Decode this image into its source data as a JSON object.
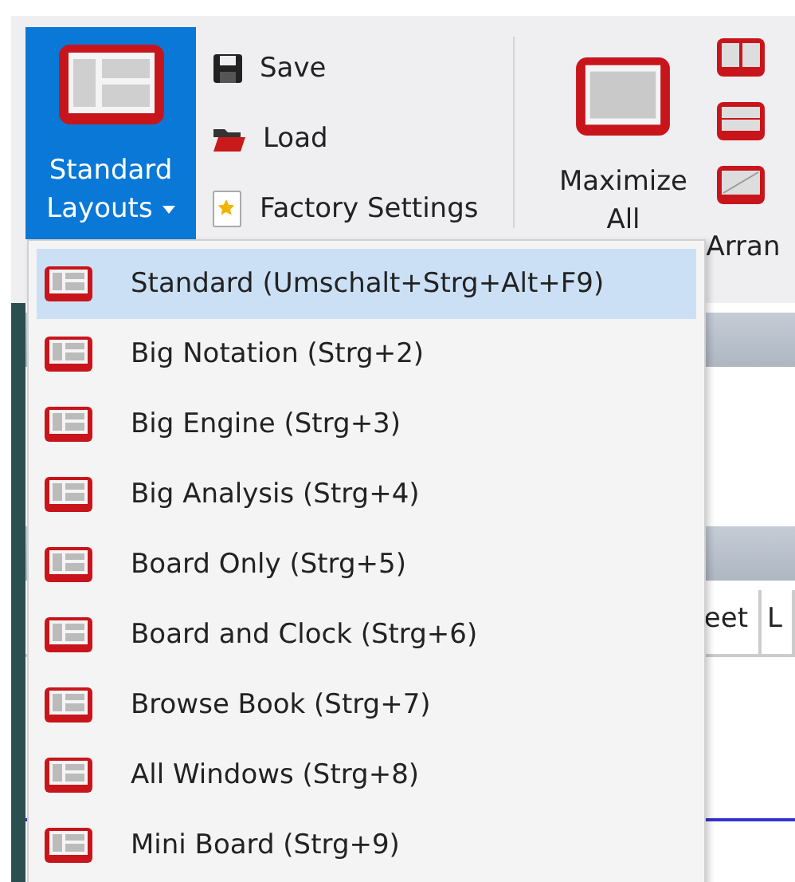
{
  "ribbon": {
    "layouts_button": {
      "label_lines": [
        "Standard",
        "Layouts"
      ],
      "expanded": true
    },
    "commands": [
      {
        "label": "Save",
        "kind": "save"
      },
      {
        "label": "Load",
        "kind": "load"
      },
      {
        "label": "Factory Settings",
        "kind": "factory"
      }
    ],
    "maximize_button": {
      "label_lines": [
        "Maximize",
        "All"
      ]
    },
    "group_label": "Arran"
  },
  "menu": {
    "items": [
      {
        "label": "Standard (Umschalt+Strg+Alt+F9)",
        "selected": true
      },
      {
        "label": "Big Notation (Strg+2)",
        "selected": false
      },
      {
        "label": "Big Engine (Strg+3)",
        "selected": false
      },
      {
        "label": "Big Analysis (Strg+4)",
        "selected": false
      },
      {
        "label": "Board Only (Strg+5)",
        "selected": false
      },
      {
        "label": "Board and Clock (Strg+6)",
        "selected": false
      },
      {
        "label": "Browse Book (Strg+7)",
        "selected": false
      },
      {
        "label": "All Windows (Strg+8)",
        "selected": false
      },
      {
        "label": "Mini Board (Strg+9)",
        "selected": false
      }
    ]
  },
  "background_tabs": [
    {
      "label": "eet"
    },
    {
      "label": "L"
    }
  ]
}
